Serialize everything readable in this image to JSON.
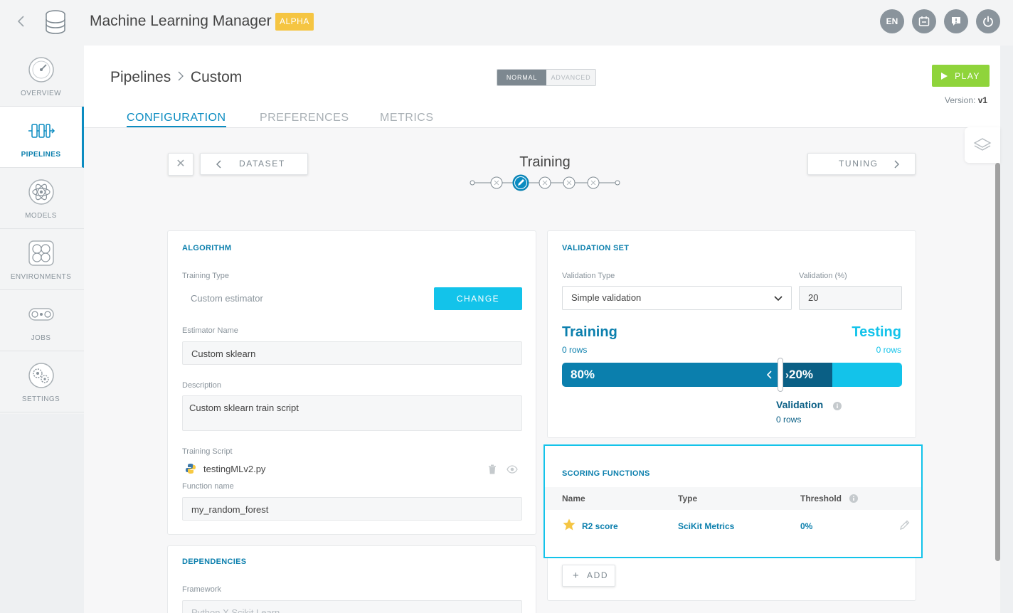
{
  "header": {
    "app_title": "Machine Learning Manager",
    "badge": "ALPHA",
    "language": "EN",
    "icons": [
      "back-chevron-icon",
      "database-icon",
      "calendar-icon",
      "feedback-icon",
      "power-icon"
    ]
  },
  "sidebar": {
    "items": [
      {
        "label": "OVERVIEW",
        "icon": "gauge-icon",
        "active": false
      },
      {
        "label": "PIPELINES",
        "icon": "pipeline-icon",
        "active": true
      },
      {
        "label": "MODELS",
        "icon": "atom-icon",
        "active": false
      },
      {
        "label": "ENVIRONMENTS",
        "icon": "cells-icon",
        "active": false
      },
      {
        "label": "JOBS",
        "icon": "conveyor-icon",
        "active": false
      },
      {
        "label": "SETTINGS",
        "icon": "gears-icon",
        "active": false
      }
    ]
  },
  "page": {
    "breadcrumb_root": "Pipelines",
    "breadcrumb_current": "Custom",
    "mode_normal": "NORMAL",
    "mode_advanced": "ADVANCED",
    "play_label": "PLAY",
    "version_label": "Version:",
    "version_value": "v1",
    "tabs": [
      {
        "label": "CONFIGURATION",
        "active": true
      },
      {
        "label": "PREFERENCES",
        "active": false
      },
      {
        "label": "METRICS",
        "active": false
      }
    ]
  },
  "stepper": {
    "prev_label": "DATASET",
    "next_label": "TUNING",
    "title": "Training",
    "current_step": 2,
    "total_steps": 5
  },
  "algorithm": {
    "title": "ALGORITHM",
    "training_type_label": "Training Type",
    "training_type_value": "Custom estimator",
    "change_label": "CHANGE",
    "estimator_name_label": "Estimator Name",
    "estimator_name_value": "Custom sklearn",
    "description_label": "Description",
    "description_value": "Custom sklearn train script",
    "training_script_label": "Training Script",
    "training_script_file": "testingMLv2.py",
    "function_name_label": "Function name",
    "function_name_value": "my_random_forest"
  },
  "dependencies": {
    "title": "DEPENDENCIES",
    "framework_label": "Framework",
    "framework_value": "Python X Scikit Learn"
  },
  "validation": {
    "title": "VALIDATION SET",
    "type_label": "Validation Type",
    "type_value": "Simple validation",
    "percent_label": "Validation (%)",
    "percent_value": "20",
    "training_label": "Training",
    "training_rows": "0 rows",
    "testing_label": "Testing",
    "testing_rows": "0 rows",
    "train_pct": "80%",
    "val_pct": "20%",
    "validation_label": "Validation",
    "validation_rows": "0 rows",
    "colors": {
      "train": "#0b7fad",
      "validation": "#0a5f85",
      "test": "#13c3ea"
    }
  },
  "scoring": {
    "title": "SCORING FUNCTIONS",
    "columns": [
      "Name",
      "Type",
      "Threshold"
    ],
    "rows": [
      {
        "name": "R2 score",
        "type": "SciKit Metrics",
        "threshold": "0%",
        "starred": true
      }
    ],
    "add_label": "ADD"
  }
}
